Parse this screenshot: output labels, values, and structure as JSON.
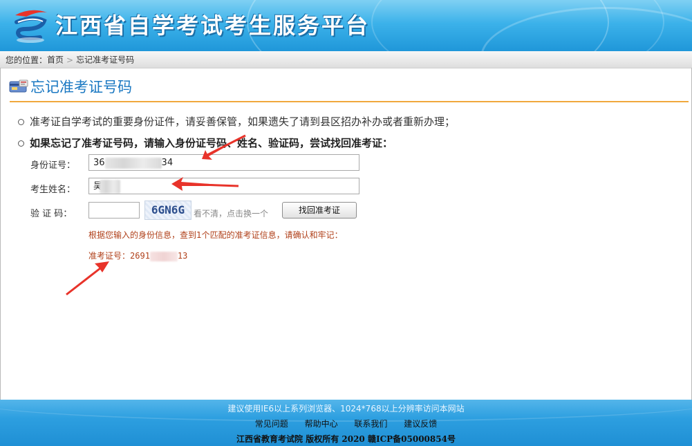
{
  "header": {
    "site_title": "江西省自学考试考生服务平台",
    "logo_icon": "swirl-logo-icon"
  },
  "breadcrumb": {
    "prefix": "您的位置：",
    "home": "首页",
    "separator": ">",
    "current": "忘记准考证号码"
  },
  "page": {
    "title": "忘记准考证号码",
    "title_icon": "card-icon"
  },
  "notes": {
    "line1": "准考证自学考试的重要身份证件，请妥善保管，如果遗失了请到县区招办补办或者重新办理；",
    "line2": "如果忘记了准考证号码，请输入身份证号码、姓名、验证码，尝试找回准考证："
  },
  "form": {
    "id_label": "身份证号：",
    "id_value_start": "36",
    "id_value_end": "34",
    "name_label": "考生姓名：",
    "name_value_start": "吴",
    "captcha_label": "验 证 码：",
    "captcha_value": "",
    "captcha_text": "6GN6G",
    "captcha_refresh": "看不清，点击换一个",
    "submit_label": "找回准考证"
  },
  "result": {
    "message": "根据您输入的身份信息，查到1个匹配的准考证信息，请确认和牢记：",
    "number_label": "准考证号：",
    "number_start": "2691",
    "number_end": "13"
  },
  "footer": {
    "tip": "建议使用IE6以上系列浏览器、1024*768以上分辨率访问本网站",
    "links": [
      "常见问题",
      "帮助中心",
      "联系我们",
      "建议反馈"
    ],
    "copyright": "江西省教育考试院 版权所有 2020 赣ICP备05000854号"
  },
  "colors": {
    "header_blue": "#3cb2ea",
    "title_blue": "#1a78c2",
    "rule_orange": "#f0a83c",
    "result_red": "#b0401a",
    "arrow_red": "#e8332a"
  }
}
